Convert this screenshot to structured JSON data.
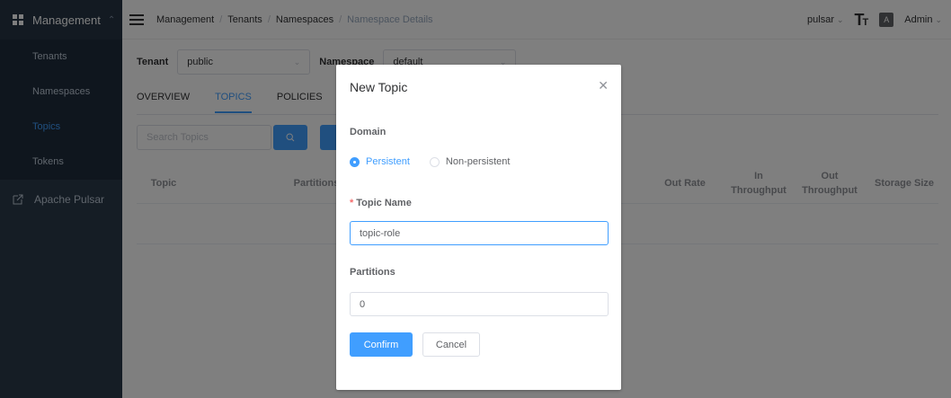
{
  "sidebar": {
    "header_label": "Management",
    "items": [
      {
        "label": "Tenants"
      },
      {
        "label": "Namespaces"
      },
      {
        "label": "Topics"
      },
      {
        "label": "Tokens"
      }
    ],
    "external_link": "Apache Pulsar"
  },
  "breadcrumb": {
    "items": [
      "Management",
      "Tenants",
      "Namespaces"
    ],
    "current": "Namespace Details",
    "separator": "/"
  },
  "topbar": {
    "tenant_selector": "pulsar",
    "user": "Admin",
    "lang_icon_text": "A"
  },
  "filters": {
    "tenant_label": "Tenant",
    "tenant_value": "public",
    "namespace_label": "Namespace",
    "namespace_value": "default"
  },
  "tabs": [
    {
      "label": "OVERVIEW"
    },
    {
      "label": "TOPICS",
      "active": true
    },
    {
      "label": "POLICIES"
    }
  ],
  "search": {
    "placeholder": "Search Topics"
  },
  "table": {
    "columns": [
      "Topic",
      "Partitions",
      "Out Rate",
      "In Throughput",
      "Out Throughput",
      "Storage Size"
    ]
  },
  "modal": {
    "title": "New Topic",
    "domain_label": "Domain",
    "domain_options": [
      {
        "label": "Persistent",
        "checked": true
      },
      {
        "label": "Non-persistent",
        "checked": false
      }
    ],
    "topic_name_label": "Topic Name",
    "topic_name_value": "topic-role",
    "partitions_label": "Partitions",
    "partitions_value": "0",
    "confirm_label": "Confirm",
    "cancel_label": "Cancel"
  },
  "colors": {
    "primary": "#409eff",
    "sidebar_bg": "#2b3a4a",
    "required": "#f56c6c"
  }
}
